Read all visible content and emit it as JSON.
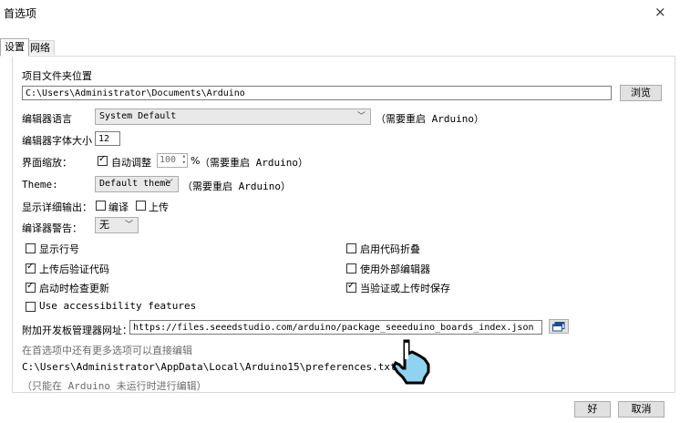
{
  "window": {
    "title": "首选项",
    "close_glyph": "×"
  },
  "tabs": [
    {
      "label": "设置"
    },
    {
      "label": "网络"
    }
  ],
  "sketchbook": {
    "label": "项目文件夹位置",
    "path": "C:\\Users\\Administrator\\Documents\\Arduino",
    "browse_label": "浏览"
  },
  "editor_language": {
    "label": "编辑器语言",
    "value": "System Default",
    "note": "（需要重启 Arduino）"
  },
  "font_size": {
    "label": "编辑器字体大小",
    "value": "12"
  },
  "interface_scale": {
    "label": "界面缩放：",
    "auto_label": "自动调整",
    "auto_checked": true,
    "value": "100",
    "suffix": "%",
    "note": "（需要重启 Arduino）"
  },
  "theme": {
    "label": "Theme:",
    "value": "Default theme",
    "note": "（需要重启 Arduino）"
  },
  "verbose": {
    "label": "显示详细输出：",
    "compile_label": "编译",
    "upload_label": "上传",
    "compile_checked": false,
    "upload_checked": false
  },
  "warnings": {
    "label": "编译器警告：",
    "value": "无"
  },
  "options": [
    {
      "label": "显示行号",
      "checked": false
    },
    {
      "label": "启用代码折叠",
      "checked": false
    },
    {
      "label": "上传后验证代码",
      "checked": true
    },
    {
      "label": "使用外部编辑器",
      "checked": false
    },
    {
      "label": "启动时检查更新",
      "checked": true
    },
    {
      "label": "当验证或上传时保存",
      "checked": true
    },
    {
      "label": "Use accessibility features",
      "checked": false
    }
  ],
  "boards_manager": {
    "label": "附加开发板管理器网址：",
    "url": "https://files.seeedstudio.com/arduino/package_seeeduino_boards_index.json"
  },
  "more_prefs": {
    "hint": "在首选项中还有更多选项可以直接编辑",
    "path": "C:\\Users\\Administrator\\AppData\\Local\\Arduino15\\preferences.txt",
    "note": "（只能在 Arduino 未运行时进行编辑）"
  },
  "footer": {
    "ok_label": "好",
    "cancel_label": "取消"
  },
  "colors": {
    "cursor_fill": "#8fd3f0",
    "panel_border": "#d9d9d9"
  },
  "icons": {
    "cursor": "hand-pointer-icon",
    "window_icon": "window-copy-icon"
  }
}
